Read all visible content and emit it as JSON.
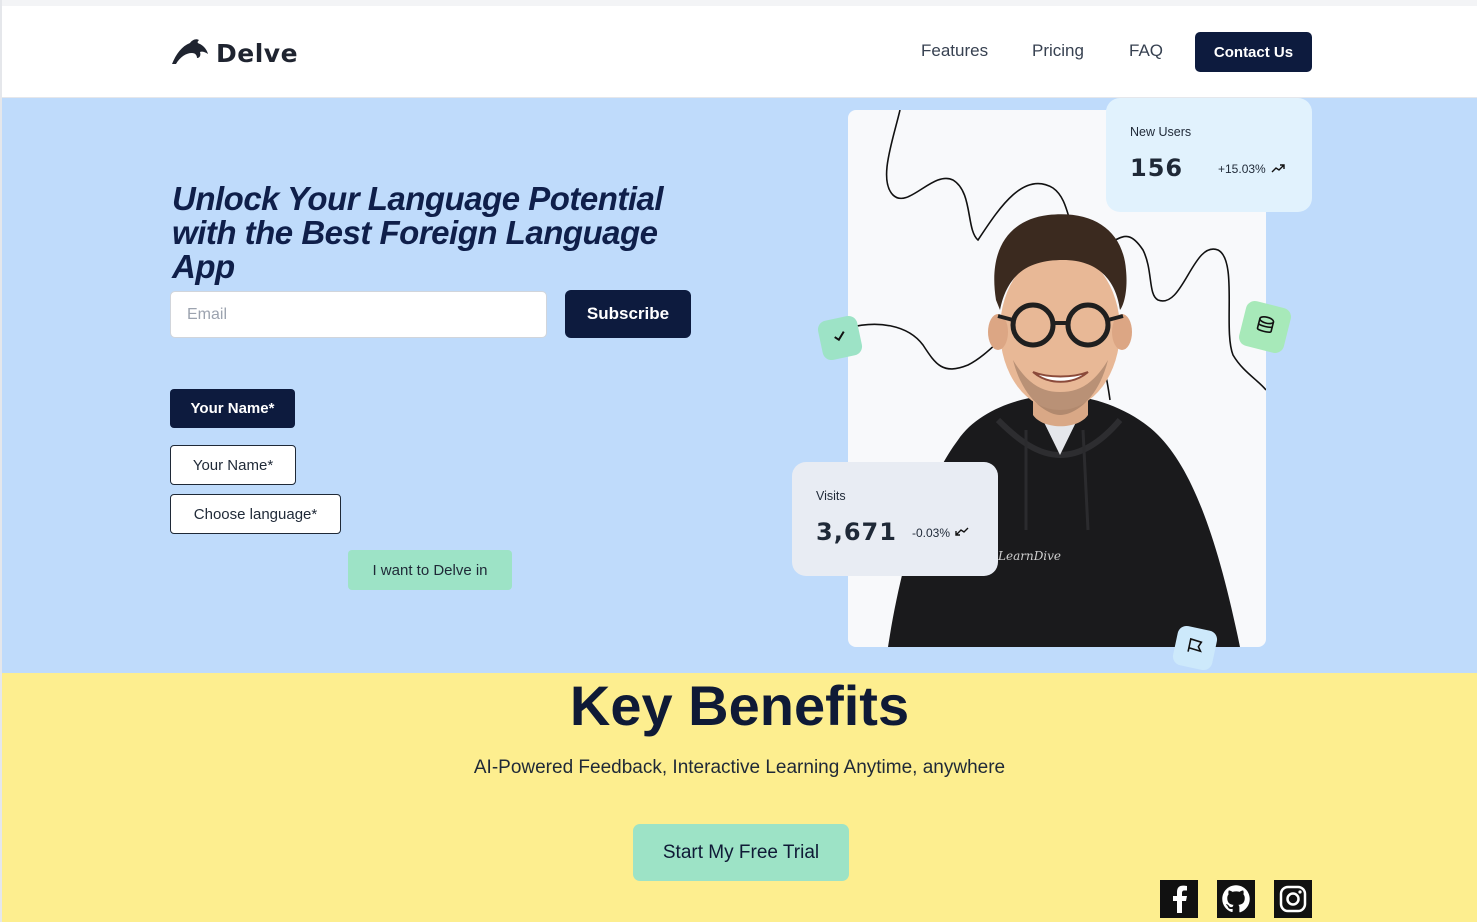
{
  "header": {
    "logo_text": "Delve",
    "nav": [
      "Features",
      "Pricing",
      "FAQ"
    ],
    "contact_label": "Contact Us"
  },
  "hero": {
    "title": "Unlock Your Language Potential with the Best Foreign Language App",
    "email_placeholder": "Email",
    "subscribe_label": "Subscribe",
    "name_button_label": "Your Name*",
    "name_field_label": "Your Name*",
    "language_select_label": "Choose language*",
    "delve_button_label": "I want to Delve in"
  },
  "stats": {
    "new_users": {
      "label": "New Users",
      "value": "156",
      "change": "+15.03%",
      "trend_icon": "trend-up-icon"
    },
    "visits": {
      "label": "Visits",
      "value": "3,671",
      "change": "-0.03%",
      "trend_icon": "trend-down-icon"
    }
  },
  "badges": [
    "check-icon",
    "database-icon",
    "flag-icon"
  ],
  "benefits": {
    "title": "Key Benefits",
    "subtitle": "AI-Powered Feedback, Interactive Learning Anytime, anywhere",
    "cta_label": "Start My Free Trial"
  },
  "social": [
    "facebook-icon",
    "github-icon",
    "instagram-icon"
  ],
  "colors": {
    "navy": "#0d1b3e",
    "hero_bg": "#bfdbfb",
    "benefits_bg": "#fdee8f",
    "mint": "#9de3c6"
  }
}
